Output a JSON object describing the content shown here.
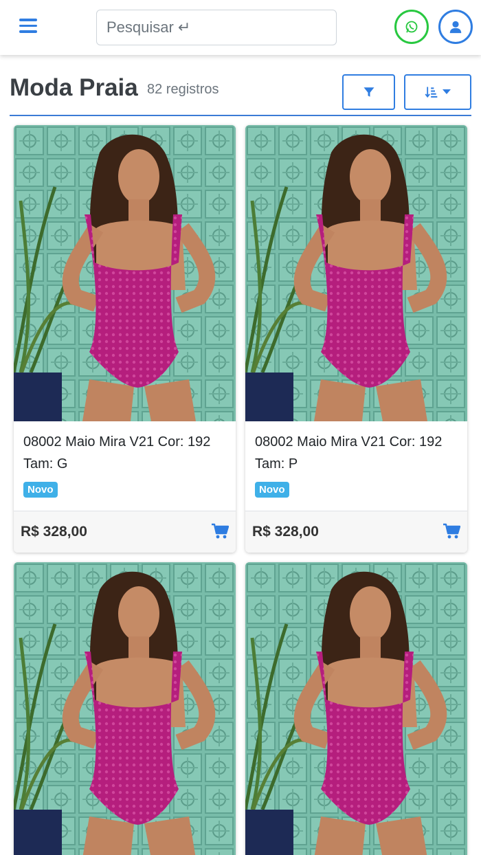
{
  "header": {
    "search_placeholder": "Pesquisar",
    "enter_symbol": "↵"
  },
  "page": {
    "title": "Moda Praia",
    "count": "82 registros"
  },
  "products": [
    {
      "name": "08002 Maio Mira V21 Cor: 192 Tam: G",
      "badge": "Novo",
      "price": "R$ 328,00"
    },
    {
      "name": "08002 Maio Mira V21 Cor: 192 Tam: P",
      "badge": "Novo",
      "price": "R$ 328,00"
    },
    {
      "name": "",
      "badge": "",
      "price": ""
    },
    {
      "name": "",
      "badge": "",
      "price": ""
    }
  ],
  "colors": {
    "accent": "#2f7de1",
    "whatsapp": "#28c840",
    "badge": "#3fb0e8",
    "swimsuit": "#b0207a"
  }
}
